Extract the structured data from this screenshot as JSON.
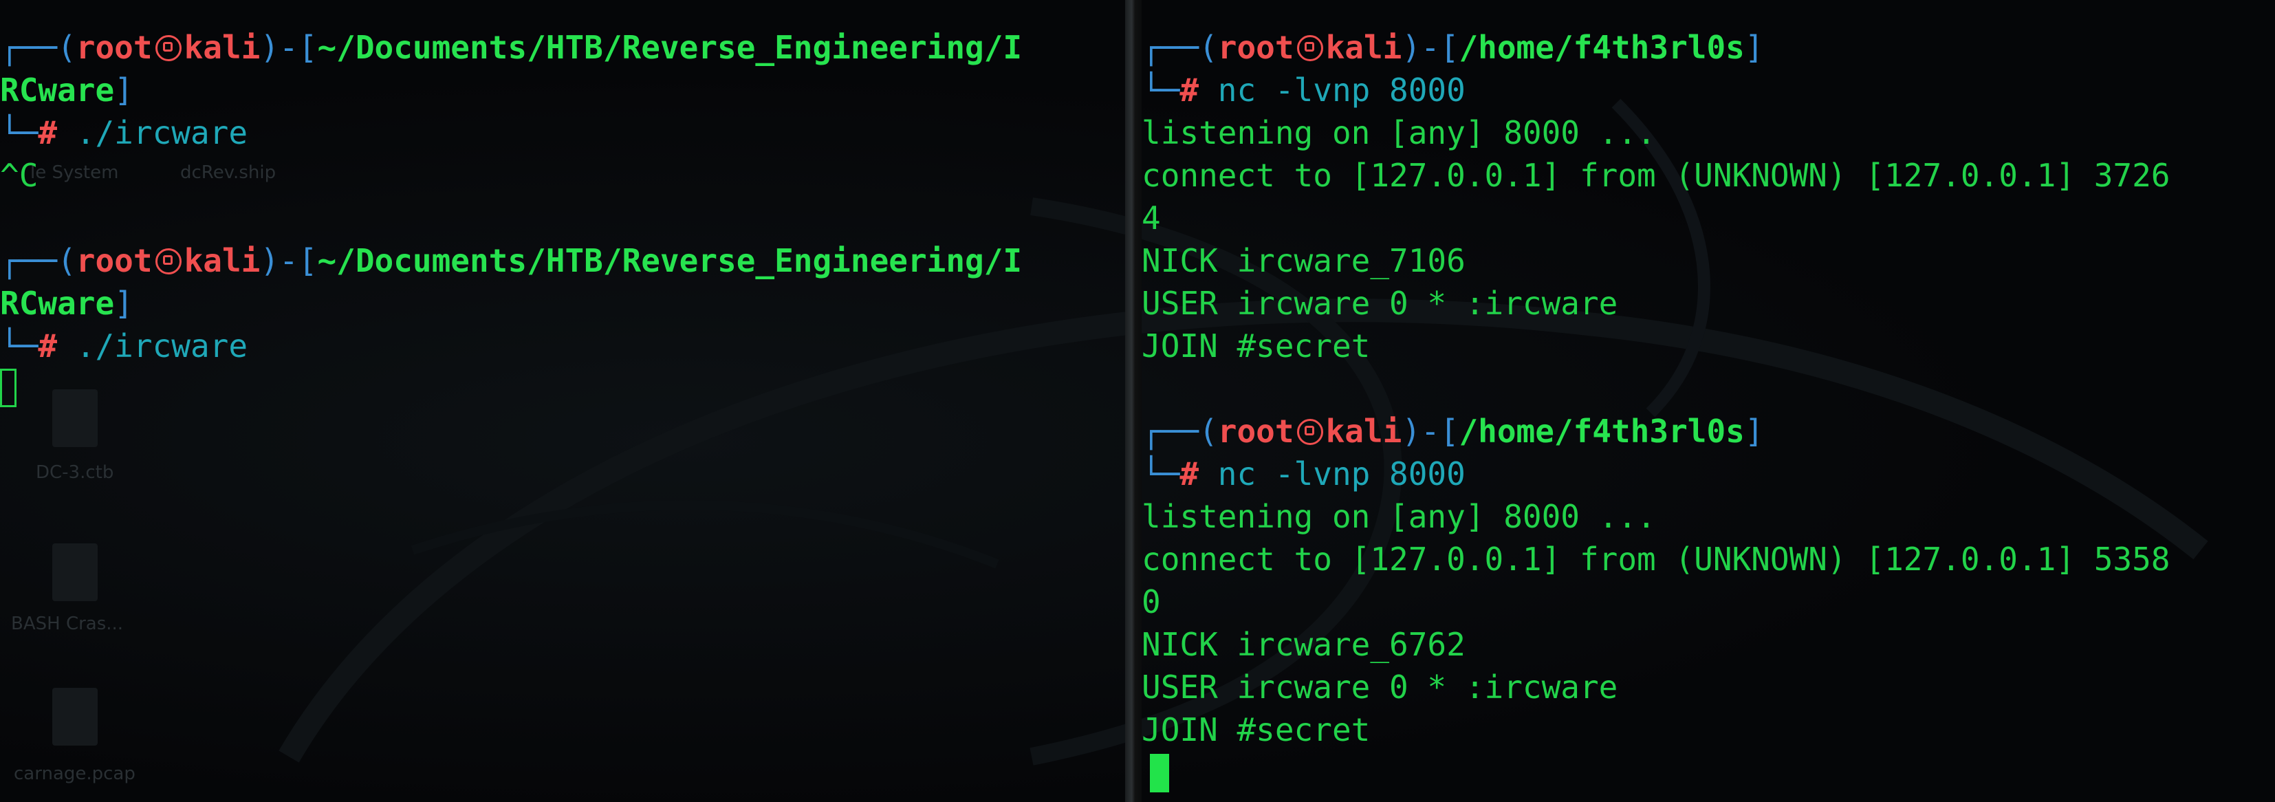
{
  "left_terminal": {
    "prompt_1": {
      "user": "root",
      "host": "kali",
      "path_part1": "~/Documents/HTB/Reverse_Engineering/I",
      "path_part2": "RCware",
      "command": "./ircware"
    },
    "interrupt_output": "^C",
    "prompt_2": {
      "user": "root",
      "host": "kali",
      "path_part1": "~/Documents/HTB/Reverse_Engineering/I",
      "path_part2": "RCware",
      "command": "./ircware"
    }
  },
  "right_terminal": {
    "session_1": {
      "user": "root",
      "host": "kali",
      "path": "/home/f4th3rl0s",
      "command": "nc -lvnp 8000",
      "output": [
        "listening on [any] 8000 ...",
        "connect to [127.0.0.1] from (UNKNOWN) [127.0.0.1] 3726",
        "4",
        "NICK ircware_7106",
        "USER ircware 0 * :ircware",
        "JOIN #secret"
      ]
    },
    "session_2": {
      "user": "root",
      "host": "kali",
      "path": "/home/f4th3rl0s",
      "command": "nc -lvnp 8000",
      "output": [
        "listening on [any] 8000 ...",
        "connect to [127.0.0.1] from (UNKNOWN) [127.0.0.1] 5358",
        "0",
        "NICK ircware_6762",
        "USER ircware 0 * :ircware",
        "JOIN #secret"
      ]
    }
  },
  "desktop_background": {
    "labels": [
      "le System",
      "dcRev.ship",
      "DC-3.ctb",
      "BASH Cras...",
      "carnage.pcap"
    ]
  },
  "colors": {
    "bracket": "#3a8fd6",
    "user_host": "#f04f4f",
    "path": "#27e34f",
    "command": "#1fa8b8",
    "output": "#22d34a"
  },
  "icons": {
    "kali_symbol": "kali-skull-icon"
  }
}
